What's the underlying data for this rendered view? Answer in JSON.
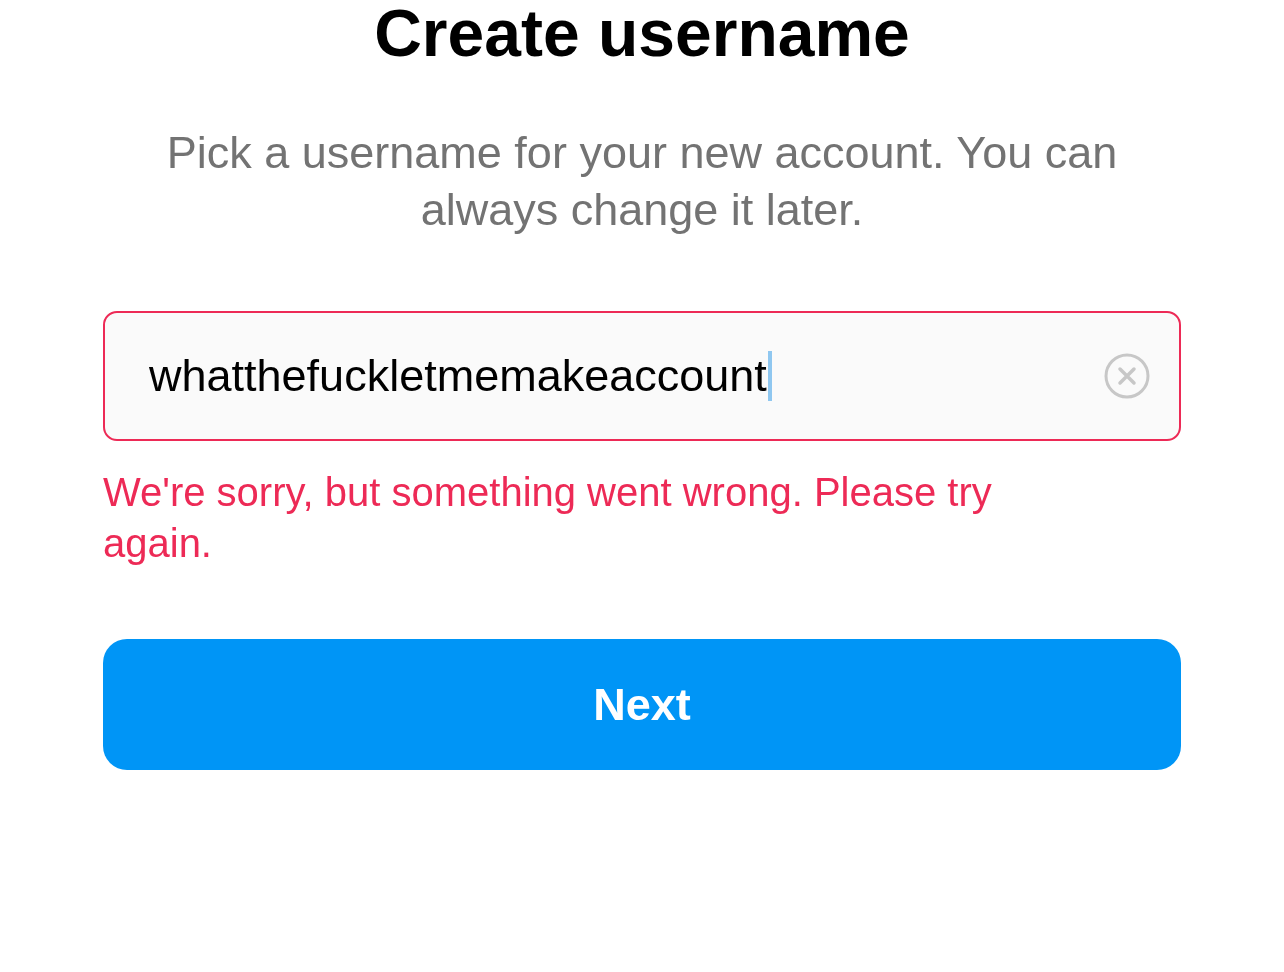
{
  "title": "Create username",
  "subtitle": "Pick a username for your new account. You can always change it later.",
  "username_field": {
    "value": "whatthefuckletmemakeaccount",
    "invalid": true,
    "focused": true
  },
  "error_message": "We're sorry, but something went wrong. Please try again.",
  "next_button": {
    "label": "Next"
  }
}
